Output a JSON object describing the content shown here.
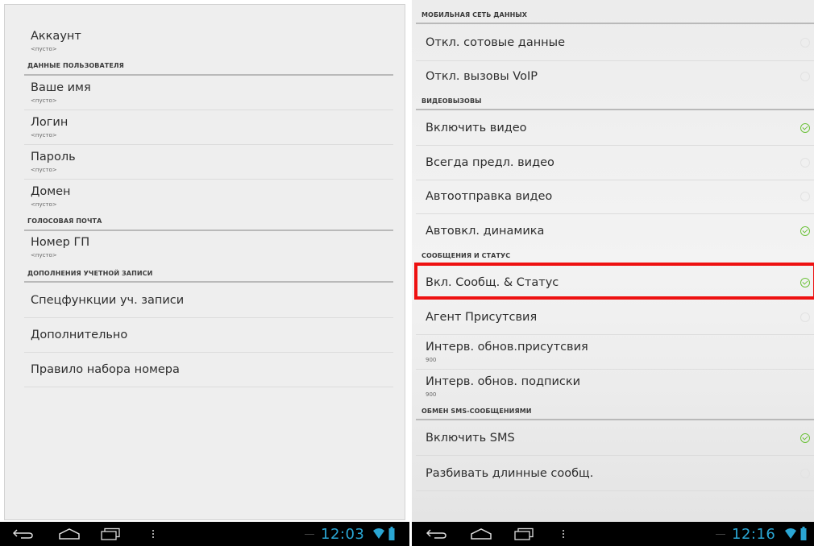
{
  "left": {
    "rows": [
      {
        "title": "Аккаунт",
        "summary": "<пусто>"
      },
      {
        "header": "ДАННЫЕ ПОЛЬЗОВАТЕЛЯ"
      },
      {
        "title": "Ваше имя",
        "summary": "<пусто>"
      },
      {
        "title": "Логин",
        "summary": "<пусто>"
      },
      {
        "title": "Пароль",
        "summary": "<пусто>"
      },
      {
        "title": "Домен",
        "summary": "<пусто>"
      },
      {
        "header": "ГОЛОСОВАЯ ПОЧТА"
      },
      {
        "title": "Номер ГП",
        "summary": "<пусто>"
      },
      {
        "header": "ДОПОЛНЕНИЯ УЧЕТНОЙ ЗАПИСИ"
      },
      {
        "title": "Спецфункции уч. записи"
      },
      {
        "title": "Дополнительно"
      },
      {
        "title": "Правило набора номера"
      }
    ],
    "status": {
      "clock": "12:03",
      "icons": [
        "back-icon",
        "home-icon",
        "recent-apps-icon",
        "menu-dots-icon",
        "wifi-icon",
        "battery-icon"
      ]
    }
  },
  "right": {
    "rows": [
      {
        "header": "МОБИЛЬНАЯ СЕТЬ ДАННЫХ"
      },
      {
        "title": "Откл. сотовые данные",
        "checked": false
      },
      {
        "title": "Откл. вызовы VoIP",
        "checked": false
      },
      {
        "header": "ВИДЕОВЫЗОВЫ"
      },
      {
        "title": "Включить видео",
        "checked": true
      },
      {
        "title": "Всегда предл. видео",
        "checked": false
      },
      {
        "title": "Автоотправка видео",
        "checked": false
      },
      {
        "title": "Автовкл. динамика",
        "checked": true
      },
      {
        "header": "СООБЩЕНИЯ И СТАТУС"
      },
      {
        "title": "Вкл. Сообщ. & Статус",
        "checked": true,
        "highlighted": true
      },
      {
        "title": "Агент Присутсвия",
        "checked": false
      },
      {
        "title": "Интерв. обнов.присутсвия",
        "summary": "900"
      },
      {
        "title": "Интерв. обнов. подписки",
        "summary": "900"
      },
      {
        "header": "ОБМЕН SMS-СООБЩЕНИЯМИ"
      },
      {
        "title": "Включить SMS",
        "checked": true
      },
      {
        "title": "Разбивать длинные сообщ.",
        "checked": false
      }
    ],
    "status": {
      "clock": "12:16",
      "icons": [
        "back-icon",
        "home-icon",
        "recent-apps-icon",
        "menu-dots-icon",
        "wifi-icon",
        "battery-icon"
      ]
    }
  },
  "colors": {
    "check_on": "#6ec23c",
    "highlight": "#ee1111",
    "clock": "#2aa6d4"
  }
}
